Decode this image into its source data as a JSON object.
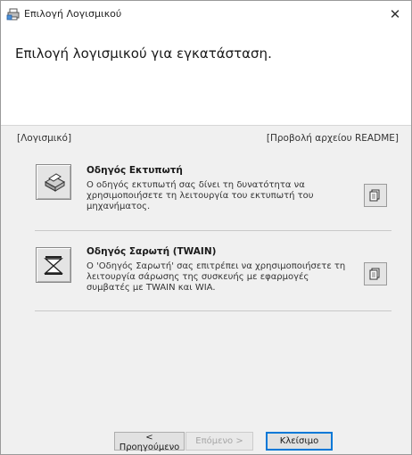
{
  "window": {
    "title": "Επιλογή Λογισμικού",
    "close_glyph": "✕"
  },
  "header": {
    "heading": "Επιλογή λογισμικού για εγκατάσταση."
  },
  "content": {
    "left_label": "[Λογισμικό]",
    "right_label": "[Προβολή αρχείου README]",
    "items": [
      {
        "title": "Οδηγός Εκτυπωτή",
        "description": "Ο οδηγός εκτυπωτή σας δίνει τη δυνατότητα να χρησιμοποιήσετε τη λειτουργία του εκτυπωτή του μηχανήματος.",
        "icon": "printer-icon",
        "readme_icon": "document-icon"
      },
      {
        "title": "Οδηγός Σαρωτή (TWAIN)",
        "description": "Ο 'Οδηγός Σαρωτή' σας επιτρέπει να χρησιμοποιήσετε τη λειτουργία σάρωσης της συσκευής με εφαρμογές συμβατές με TWAIN και WIA.",
        "icon": "scanner-icon",
        "readme_icon": "document-icon"
      }
    ]
  },
  "footer": {
    "back_label": "< Προηγούμενο",
    "next_label": "Επόμενο >",
    "close_label": "Κλείσιμο"
  }
}
